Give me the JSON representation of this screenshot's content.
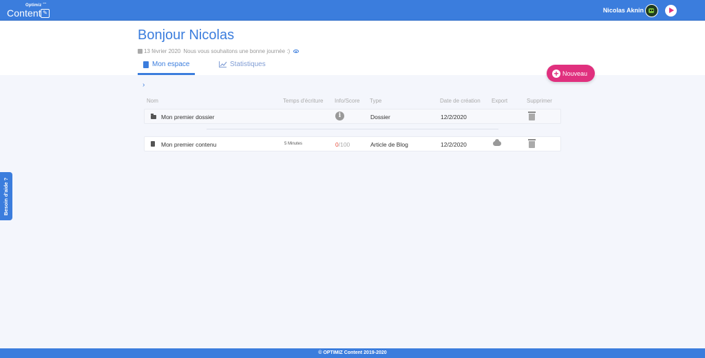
{
  "topbar": {
    "logo_small": "Optimiz",
    "logo_main": "Content",
    "user_name": "Nicolas Aknin",
    "accent_color": "#3b7ddd",
    "icons": [
      "wifi-icon",
      "pencil-icon",
      "avatar",
      "play-icon"
    ]
  },
  "header": {
    "greeting": "Bonjour Nicolas",
    "date": "13 février 2020",
    "message": "Nous vous souhaitons une bonne journée :)"
  },
  "tabs": [
    {
      "label": "Mon espace",
      "icon": "document-icon",
      "active": true
    },
    {
      "label": "Statistiques",
      "icon": "chart-icon",
      "active": false
    }
  ],
  "new_button": {
    "label": "Nouveau",
    "color": "#e0307e"
  },
  "breadcrumb": {
    "icon": "chevron-right-icon"
  },
  "table": {
    "headers": {
      "name": "Nom",
      "writing_time": "Temps d'écriture",
      "info_score": "Info/Score",
      "type": "Type",
      "created": "Date de création",
      "export": "Export",
      "delete": "Supprimer"
    },
    "rows": [
      {
        "icon": "folder-icon",
        "name": "Mon premier dossier",
        "writing_time": "",
        "score": "",
        "score_max": "",
        "type": "Dossier",
        "created": "12/2/2020"
      },
      {
        "icon": "file-icon",
        "name": "Mon premier contenu",
        "writing_time": "5 Minutes",
        "score": "0",
        "score_max": "/100",
        "type": "Article de Blog",
        "created": "12/2/2020"
      }
    ]
  },
  "help_tab": {
    "label": "Besoin d'aide ?"
  },
  "footer": {
    "text": "© OPTIMIZ Content 2019-2020"
  }
}
